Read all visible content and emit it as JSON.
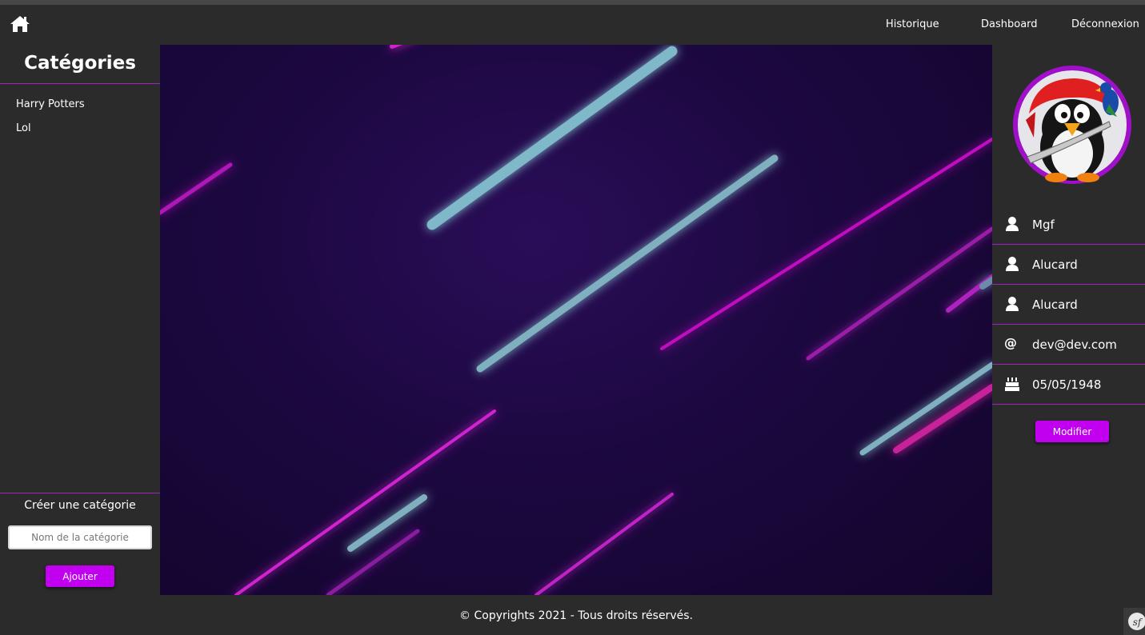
{
  "nav": {
    "home_icon": "home-icon",
    "links": [
      "Historique",
      "Dashboard",
      "Déconnexion"
    ]
  },
  "sidebar": {
    "title": "Catégories",
    "categories": [
      "Harry Potters",
      "Lol"
    ],
    "create_title": "Créer une catégorie",
    "input_placeholder": "Nom de la catégorie",
    "add_button": "Ajouter"
  },
  "profile": {
    "avatar": "pirate-penguin-avatar",
    "rows": [
      {
        "icon": "user-icon",
        "value": "Mgf"
      },
      {
        "icon": "user-icon",
        "value": "Alucard"
      },
      {
        "icon": "user-icon",
        "value": "Alucard"
      },
      {
        "icon": "at-icon",
        "value": "dev@dev.com"
      },
      {
        "icon": "birthday-cake-icon",
        "value": "05/05/1948"
      }
    ],
    "modify_button": "Modifier"
  },
  "footer": {
    "text": "© Copyrights 2021 - Tous droits réservés.",
    "badge_icon": "symfony-icon"
  },
  "colors": {
    "background": "#2b2b2b",
    "accent": "#c000ee",
    "divider": "#a020c8"
  }
}
